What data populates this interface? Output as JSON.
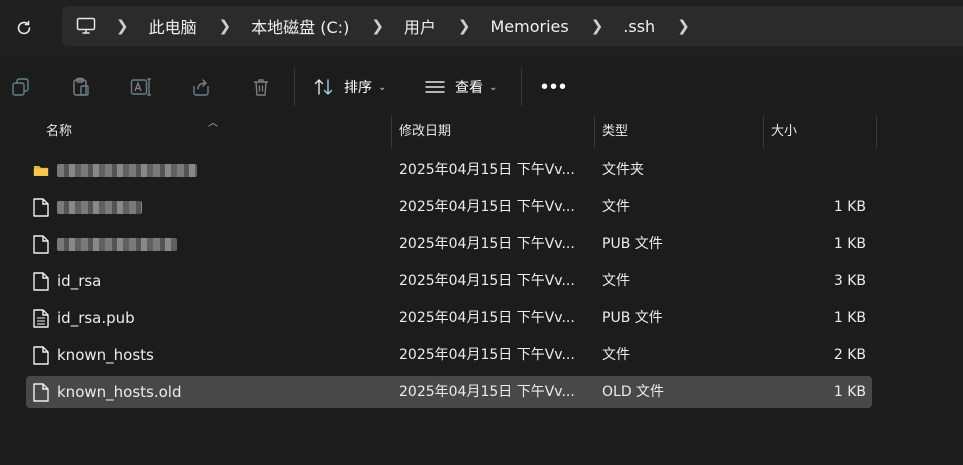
{
  "breadcrumb": [
    "此电脑",
    "本地磁盘 (C:)",
    "用户",
    "Memories",
    ".ssh"
  ],
  "toolbar": {
    "sort_label": "排序",
    "view_label": "查看",
    "more_label": "•••"
  },
  "columns": {
    "name": "名称",
    "date": "修改日期",
    "type": "类型",
    "size": "大小"
  },
  "files": [
    {
      "name": "",
      "date": "2025年04月15日 下午Vv...",
      "type": "文件夹",
      "size": "",
      "icon": "folder-icon",
      "redacted": true
    },
    {
      "name": "",
      "date": "2025年04月15日 下午Vv...",
      "type": "文件",
      "size": "1 KB",
      "icon": "file-icon",
      "redacted": true
    },
    {
      "name": "",
      "date": "2025年04月15日 下午Vv...",
      "type": "PUB 文件",
      "size": "1 KB",
      "icon": "file-icon",
      "redacted": true
    },
    {
      "name": "id_rsa",
      "date": "2025年04月15日 下午Vv...",
      "type": "文件",
      "size": "3 KB",
      "icon": "file-icon"
    },
    {
      "name": "id_rsa.pub",
      "date": "2025年04月15日 下午Vv...",
      "type": "PUB 文件",
      "size": "1 KB",
      "icon": "text-file-icon"
    },
    {
      "name": "known_hosts",
      "date": "2025年04月15日 下午Vv...",
      "type": "文件",
      "size": "2 KB",
      "icon": "file-icon"
    },
    {
      "name": "known_hosts.old",
      "date": "2025年04月15日 下午Vv...",
      "type": "OLD 文件",
      "size": "1 KB",
      "icon": "file-icon",
      "selected": true
    }
  ]
}
